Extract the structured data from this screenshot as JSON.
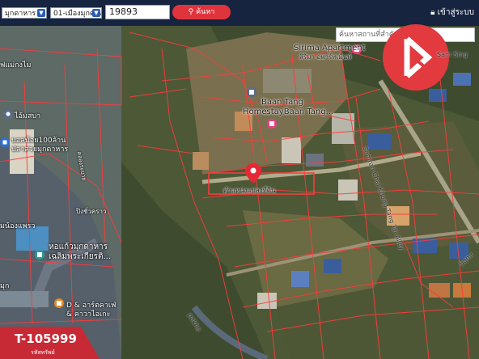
{
  "topbar": {
    "province": "มุกดาหาร",
    "district": "01-เมืองมุกดาหาร",
    "code_value": "19893",
    "search_label": "ค้นหา",
    "login_label": "เข้าสู่ระบบ"
  },
  "place_search": {
    "placeholder": "ค้นหาสถานที่สำคัญ"
  },
  "listing": {
    "code": "T-105999",
    "subtitle": "รหัสทรัพย์"
  },
  "map_labels": {
    "sirima": "Sirima Apartment",
    "sirima_th": "สิริมา อพาร์ทเม้นท์",
    "baan_tang": "Baan Tang",
    "homestay": "HomestayBaan Tang...",
    "pin_label": "ตำแหน่งแปลงที่ดิน",
    "left_top": "ฟแม่กงไม",
    "left_a": "ไอ้มสบา",
    "left_b1": "บอลน้อย100ล้าน",
    "left_b2": "ปลาสวยมุกดาหาร",
    "left_c": "คลองระบาย",
    "left_d": "ปิงชั่วคราว",
    "left_e": "มน้องแพรว",
    "left_f1": "หอแก้วมุกดาหาร",
    "left_f2": "เฉลิมพระเกียรติ...",
    "left_g": "มุก",
    "left_h1": "D & อาร์ตคาเฟ่",
    "left_h2": "& คาวาไอเกะ",
    "road_1": "Samran Chai Khong Tang Tai Alley",
    "road_2": "Samr",
    "road_3": "pakhe",
    "right_top": "Sam Sing"
  },
  "colors": {
    "topbar": "#16243f",
    "accent": "#e0343d",
    "parcel_line": "#ff3b3b"
  }
}
